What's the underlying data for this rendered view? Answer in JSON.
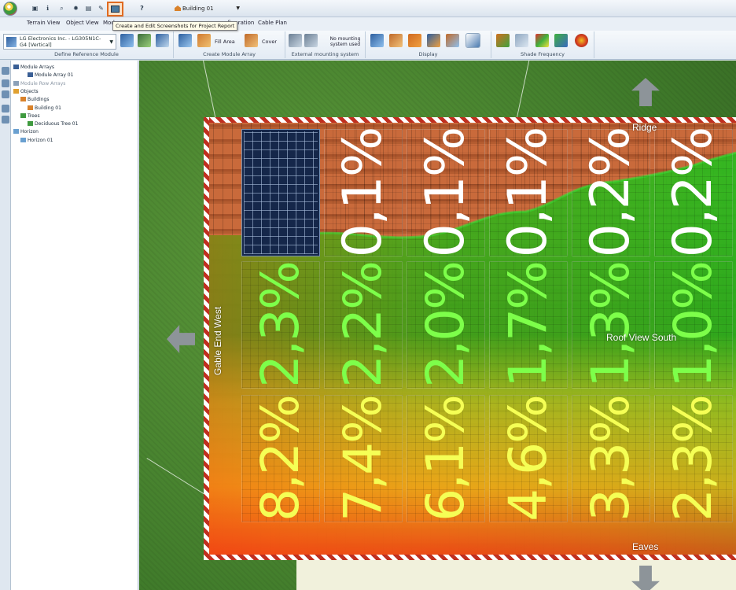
{
  "qat": {
    "building": "Building 01",
    "help": "?",
    "tooltip": "Create and Edit Screenshots for Project Report"
  },
  "tabs": [
    "Terrain View",
    "Object View",
    "Mod",
    "nfiguration",
    "Cable Plan"
  ],
  "ribbon": {
    "module": "LG Electronics Inc. - LG305N1C-G4 [Vertical]",
    "define_label": "Define Reference Module",
    "fill_area": "Fill Area",
    "cover": "Cover",
    "create_array_label": "Create Module Array",
    "no_mounting": "No mounting system used",
    "external_label": "External mounting system",
    "display_label": "Display",
    "shade_label": "Shade Frequency"
  },
  "tree": [
    {
      "label": "Module Arrays",
      "indent": 0,
      "icon": "module-icon",
      "muted": false
    },
    {
      "label": "Module Array 01",
      "indent": 2,
      "icon": "module-icon",
      "muted": false
    },
    {
      "label": "Module Row Arrays",
      "indent": 0,
      "icon": "row-icon",
      "muted": true
    },
    {
      "label": "Objects",
      "indent": 0,
      "icon": "folder-icon",
      "muted": false
    },
    {
      "label": "Buildings",
      "indent": 1,
      "icon": "building-icon",
      "muted": false
    },
    {
      "label": "Building 01",
      "indent": 2,
      "icon": "building-icon",
      "muted": false
    },
    {
      "label": "Trees",
      "indent": 1,
      "icon": "tree-icon",
      "muted": false
    },
    {
      "label": "Deciduous Tree 01",
      "indent": 2,
      "icon": "tree-icon",
      "muted": false
    },
    {
      "label": "Horizon",
      "indent": 0,
      "icon": "horizon-icon",
      "muted": false
    },
    {
      "label": "Horizon 01",
      "indent": 1,
      "icon": "horizon-icon",
      "muted": false
    }
  ],
  "roof": {
    "ridge": "Ridge",
    "eaves": "Eaves",
    "gable": "Gable End West",
    "view": "Roof View South"
  },
  "shade": {
    "top": [
      "",
      "0,1%",
      "0,1%",
      "0,1%",
      "0,2%",
      "0,2%"
    ],
    "middle": [
      "2,3%",
      "2,2%",
      "2,0%",
      "1,7%",
      "1,3%",
      "1,0%"
    ],
    "bottom": [
      "8,2%",
      "7,4%",
      "6,1%",
      "4,6%",
      "3,3%",
      "2,3%"
    ]
  },
  "colors": {
    "text_top": "#ffffff",
    "text_mid": "#7dff4a",
    "text_bottom": "#f5ff55"
  }
}
